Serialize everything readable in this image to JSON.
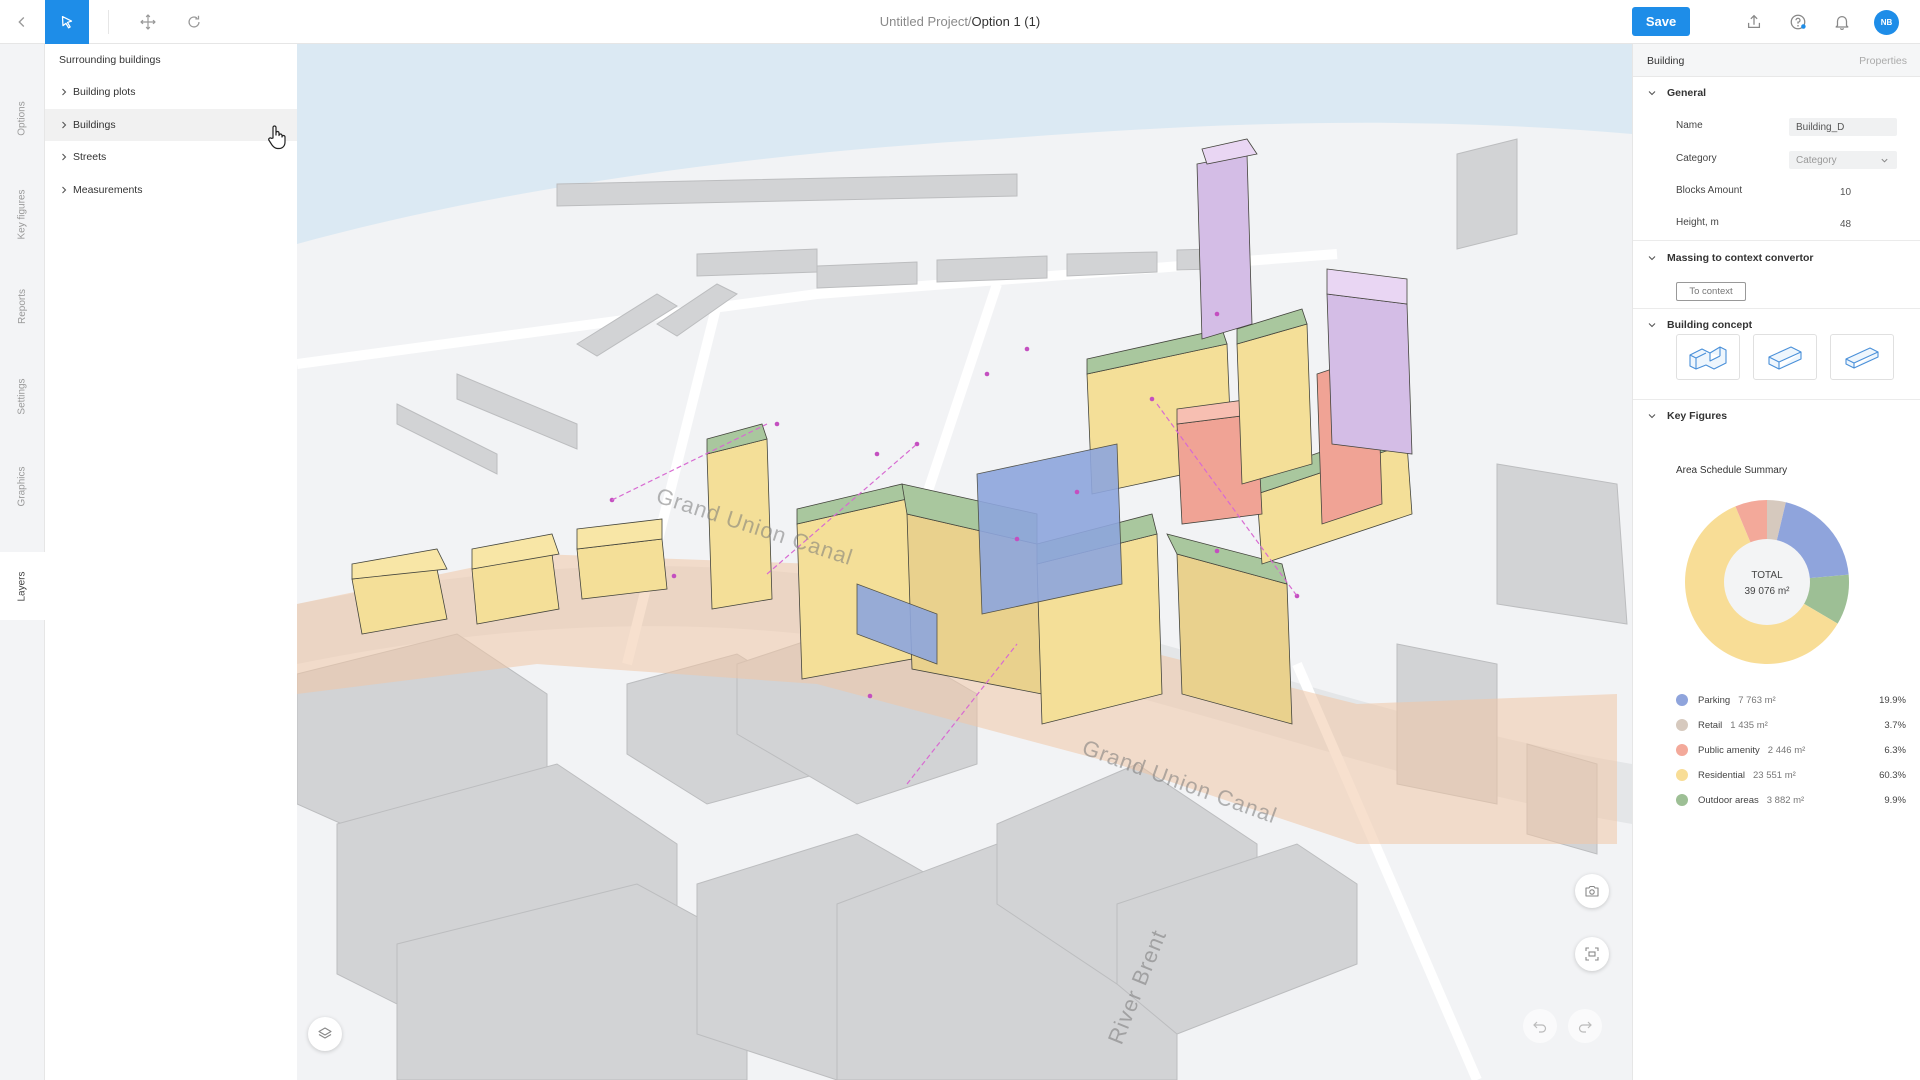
{
  "toolbar": {
    "back_icon": "chevron-left-icon",
    "select_icon": "pointer-icon",
    "move_icon": "move-arrows-icon",
    "rotate_icon": "rotate-icon",
    "project_name": "Untitled Project/",
    "option_name": "Option 1 (1)",
    "save_label": "Save",
    "upload_icon": "upload-icon",
    "help_icon": "help-icon",
    "bell_icon": "bell-icon",
    "avatar_initials": "NB",
    "accent_color": "#1e8de8"
  },
  "side_tabs": [
    "Options",
    "Key figures",
    "Reports",
    "Settings",
    "Graphics",
    "Layers"
  ],
  "side_tabs_active": "Layers",
  "layers": {
    "title": "Surrounding buildings",
    "items": [
      "Building plots",
      "Buildings",
      "Streets",
      "Measurements"
    ],
    "hovered": "Buildings"
  },
  "map": {
    "labels": [
      "Grand Union Canal",
      "Grand Union Canal",
      "River Brent"
    ],
    "buttons": [
      "layers-icon",
      "camera-icon",
      "capture-icon",
      "undo-icon",
      "redo-icon"
    ]
  },
  "properties": {
    "head_left": "Building",
    "head_right": "Properties",
    "general": {
      "title": "General",
      "name_label": "Name",
      "name_value": "Building_D",
      "category_label": "Category",
      "category_value": "Category",
      "blocks_label": "Blocks Amount",
      "blocks_value": "10",
      "height_label": "Height, m",
      "height_value": "48"
    },
    "massing": {
      "title": "Massing to context convertor",
      "button": "To context"
    },
    "concept": {
      "title": "Building concept"
    },
    "key_figures": {
      "title": "Key Figures",
      "subtitle": "Area Schedule Summary",
      "total_label": "TOTAL",
      "total_value": "39 076 m²"
    }
  },
  "chart_data": {
    "type": "pie",
    "title": "Area Schedule Summary",
    "series": [
      {
        "name": "Parking",
        "area": "7 763 m²",
        "pct_label": "19.9%",
        "value": 19.9,
        "color": "#8fa4dc"
      },
      {
        "name": "Retail",
        "area": "1 435 m²",
        "pct_label": "3.7%",
        "value": 3.7,
        "color": "#d6c9be"
      },
      {
        "name": "Public amenity",
        "area": "2 446 m²",
        "pct_label": "6.3%",
        "value": 6.3,
        "color": "#f3a99a"
      },
      {
        "name": "Residential",
        "area": "23 551 m²",
        "pct_label": "60.3%",
        "value": 60.3,
        "color": "#f8dd96"
      },
      {
        "name": "Outdoor areas",
        "area": "3 882 m²",
        "pct_label": "9.9%",
        "value": 9.9,
        "color": "#9dbf95"
      }
    ],
    "order_clockwise_from_top": [
      "Retail",
      "Parking",
      "Outdoor areas",
      "Residential",
      "Public amenity"
    ]
  }
}
